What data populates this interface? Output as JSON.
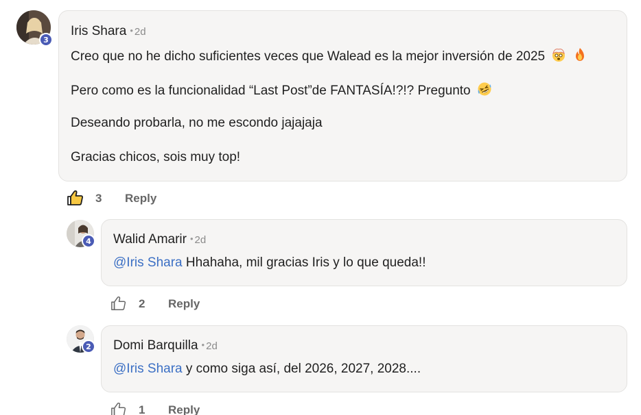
{
  "comments": [
    {
      "author": "Iris Shara",
      "time": "2d",
      "level": "3",
      "paragraphs": [
        "Creo que no he dicho suficientes veces que Walead es la mejor inversión de 2025",
        "Pero como es la funcionalidad “Last Post”de FANTASÍA!?!? Pregunto",
        "Deseando probarla, no me escondo jajajaja",
        "Gracias chicos, sois muy top!"
      ],
      "emojis": [
        "exploding-head-emoji",
        "fire-emoji",
        "rofl-emoji"
      ],
      "likes": "3",
      "liked": true,
      "reply_label": "Reply"
    },
    {
      "author": "Walid Amarir",
      "time": "2d",
      "level": "4",
      "mention": "@Iris Shara",
      "text": " Hhahaha, mil gracias Iris y lo que queda!!",
      "likes": "2",
      "liked": false,
      "reply_label": "Reply"
    },
    {
      "author": "Domi Barquilla",
      "time": "2d",
      "level": "2",
      "mention": "@Iris Shara",
      "text": " y como siga así, del 2026, 2027, 2028....",
      "likes": "1",
      "liked": false,
      "reply_label": "Reply"
    }
  ],
  "colors": {
    "mention": "#3b6fc4",
    "badge": "#4a5bb5",
    "bubble": "#f6f5f4",
    "bubble_border": "#e3e2e0",
    "meta": "#666666"
  }
}
